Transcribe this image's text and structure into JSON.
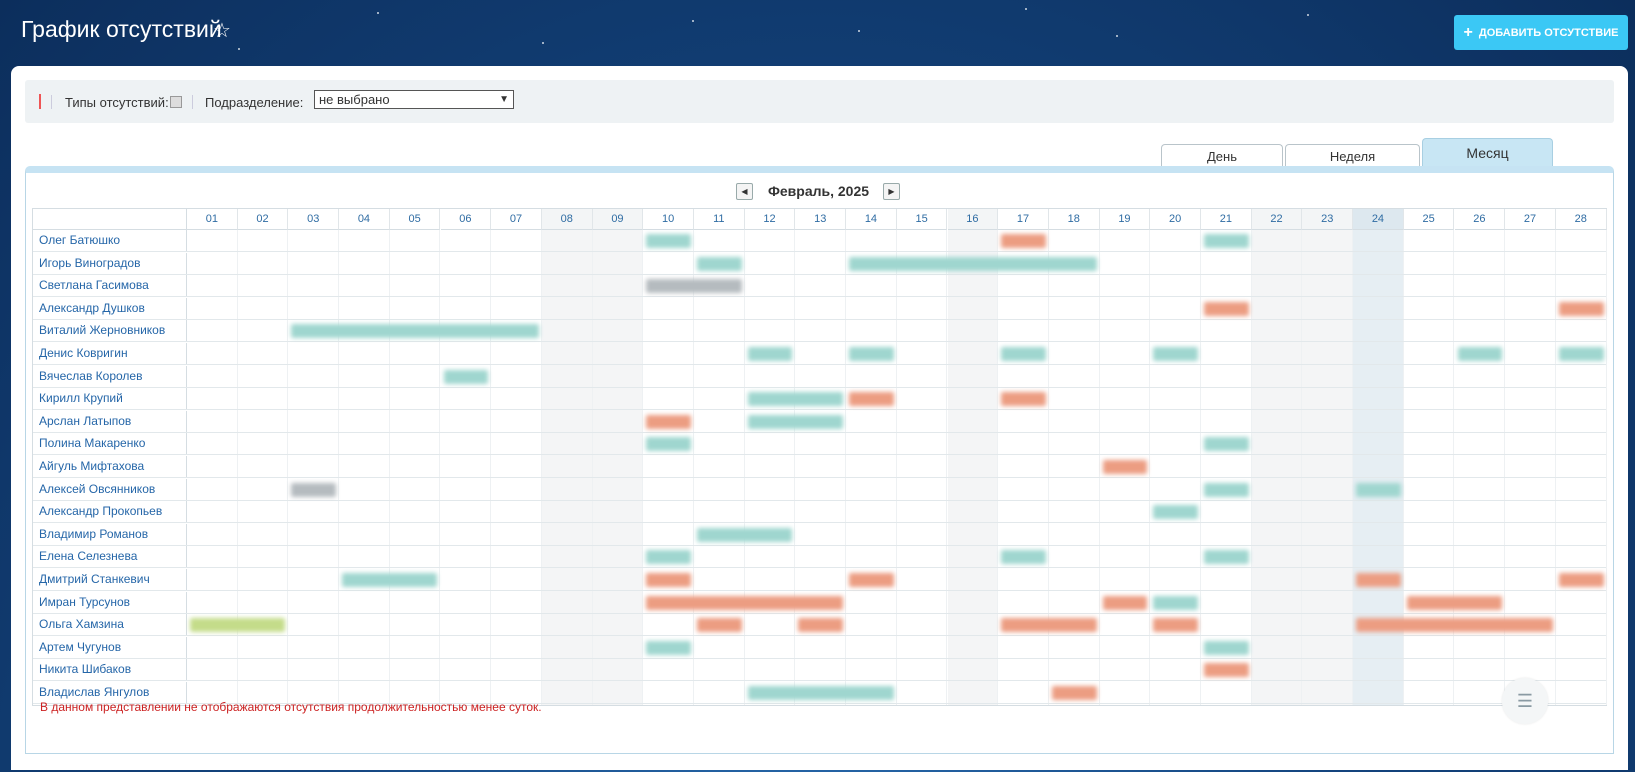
{
  "header": {
    "title": "График отсутствий",
    "star_icon": "star-outline-icon",
    "add_button_label": "ДОБАВИТЬ ОТСУТСТВИЕ"
  },
  "filters": {
    "types_label": "Типы отсутствий:",
    "department_label": "Подразделение:",
    "department_value": "не выбрано"
  },
  "tabs": [
    {
      "label": "День",
      "active": false
    },
    {
      "label": "Неделя",
      "active": false
    },
    {
      "label": "Месяц",
      "active": true
    }
  ],
  "calendar": {
    "month_title": "Февраль, 2025",
    "days": [
      "01",
      "02",
      "03",
      "04",
      "05",
      "06",
      "07",
      "08",
      "09",
      "10",
      "11",
      "12",
      "13",
      "14",
      "15",
      "16",
      "17",
      "18",
      "19",
      "20",
      "21",
      "22",
      "23",
      "24",
      "25",
      "26",
      "27",
      "28"
    ],
    "weekend_days": [
      "08",
      "09",
      "16",
      "22",
      "23"
    ],
    "today_day": "24",
    "employees": [
      "Олег Батюшко",
      "Игорь Виноградов",
      "Светлана Гасимова",
      "Александр Душков",
      "Виталий Жерновников",
      "Денис Ковригин",
      "Вячеслав Королев",
      "Кирилл Крупий",
      "Арслан Латыпов",
      "Полина Макаренко",
      "Айгуль Мифтахова",
      "Алексей Овсянников",
      "Александр Прокопьев",
      "Владимир Романов",
      "Елена Селезнева",
      "Дмитрий Станкевич",
      "Имран Турсунов",
      "Ольга Хамзина",
      "Артем Чугунов",
      "Никита Шибаков",
      "Владислав Янгулов"
    ],
    "absences": [
      {
        "row": 0,
        "start": 10,
        "end": 10,
        "color": "teal"
      },
      {
        "row": 0,
        "start": 17,
        "end": 17,
        "color": "orange"
      },
      {
        "row": 0,
        "start": 21,
        "end": 21,
        "color": "teal"
      },
      {
        "row": 1,
        "start": 11,
        "end": 11,
        "color": "teal"
      },
      {
        "row": 1,
        "start": 14,
        "end": 18,
        "color": "teal"
      },
      {
        "row": 2,
        "start": 10,
        "end": 11,
        "color": "gray"
      },
      {
        "row": 3,
        "start": 21,
        "end": 21,
        "color": "orange"
      },
      {
        "row": 3,
        "start": 28,
        "end": 28,
        "color": "orange"
      },
      {
        "row": 4,
        "start": 3,
        "end": 7,
        "color": "teal"
      },
      {
        "row": 5,
        "start": 12,
        "end": 12,
        "color": "teal"
      },
      {
        "row": 5,
        "start": 14,
        "end": 14,
        "color": "teal"
      },
      {
        "row": 5,
        "start": 17,
        "end": 17,
        "color": "teal"
      },
      {
        "row": 5,
        "start": 20,
        "end": 20,
        "color": "teal"
      },
      {
        "row": 5,
        "start": 26,
        "end": 26,
        "color": "teal"
      },
      {
        "row": 5,
        "start": 28,
        "end": 28,
        "color": "teal"
      },
      {
        "row": 6,
        "start": 6,
        "end": 6,
        "color": "teal"
      },
      {
        "row": 7,
        "start": 12,
        "end": 13,
        "color": "teal"
      },
      {
        "row": 7,
        "start": 14,
        "end": 14,
        "color": "orange"
      },
      {
        "row": 7,
        "start": 17,
        "end": 17,
        "color": "orange"
      },
      {
        "row": 8,
        "start": 10,
        "end": 10,
        "color": "orange"
      },
      {
        "row": 8,
        "start": 12,
        "end": 13,
        "color": "teal"
      },
      {
        "row": 9,
        "start": 10,
        "end": 10,
        "color": "teal"
      },
      {
        "row": 9,
        "start": 21,
        "end": 21,
        "color": "teal"
      },
      {
        "row": 10,
        "start": 19,
        "end": 19,
        "color": "orange"
      },
      {
        "row": 11,
        "start": 3,
        "end": 3,
        "color": "gray"
      },
      {
        "row": 11,
        "start": 21,
        "end": 21,
        "color": "teal"
      },
      {
        "row": 11,
        "start": 24,
        "end": 24,
        "color": "teal"
      },
      {
        "row": 12,
        "start": 20,
        "end": 20,
        "color": "teal"
      },
      {
        "row": 13,
        "start": 11,
        "end": 12,
        "color": "teal"
      },
      {
        "row": 14,
        "start": 10,
        "end": 10,
        "color": "teal"
      },
      {
        "row": 14,
        "start": 17,
        "end": 17,
        "color": "teal"
      },
      {
        "row": 14,
        "start": 21,
        "end": 21,
        "color": "teal"
      },
      {
        "row": 15,
        "start": 4,
        "end": 5,
        "color": "teal"
      },
      {
        "row": 15,
        "start": 10,
        "end": 10,
        "color": "orange"
      },
      {
        "row": 15,
        "start": 14,
        "end": 14,
        "color": "orange"
      },
      {
        "row": 15,
        "start": 24,
        "end": 24,
        "color": "orange"
      },
      {
        "row": 15,
        "start": 28,
        "end": 28,
        "color": "orange"
      },
      {
        "row": 16,
        "start": 10,
        "end": 13,
        "color": "orange"
      },
      {
        "row": 16,
        "start": 19,
        "end": 19,
        "color": "orange"
      },
      {
        "row": 16,
        "start": 20,
        "end": 20,
        "color": "teal"
      },
      {
        "row": 16,
        "start": 25,
        "end": 26,
        "color": "orange"
      },
      {
        "row": 17,
        "start": 1,
        "end": 2,
        "color": "lime"
      },
      {
        "row": 17,
        "start": 11,
        "end": 11,
        "color": "orange"
      },
      {
        "row": 17,
        "start": 13,
        "end": 13,
        "color": "orange"
      },
      {
        "row": 17,
        "start": 17,
        "end": 18,
        "color": "orange"
      },
      {
        "row": 17,
        "start": 20,
        "end": 20,
        "color": "orange"
      },
      {
        "row": 17,
        "start": 24,
        "end": 27,
        "color": "orange"
      },
      {
        "row": 18,
        "start": 10,
        "end": 10,
        "color": "teal"
      },
      {
        "row": 18,
        "start": 21,
        "end": 21,
        "color": "teal"
      },
      {
        "row": 19,
        "start": 21,
        "end": 21,
        "color": "orange"
      },
      {
        "row": 20,
        "start": 12,
        "end": 14,
        "color": "teal"
      },
      {
        "row": 20,
        "start": 18,
        "end": 18,
        "color": "orange"
      }
    ]
  },
  "footnote": "В данном представлении не отображаются отсутствия продолжительностью менее суток.",
  "list_button_icon": "list-icon"
}
